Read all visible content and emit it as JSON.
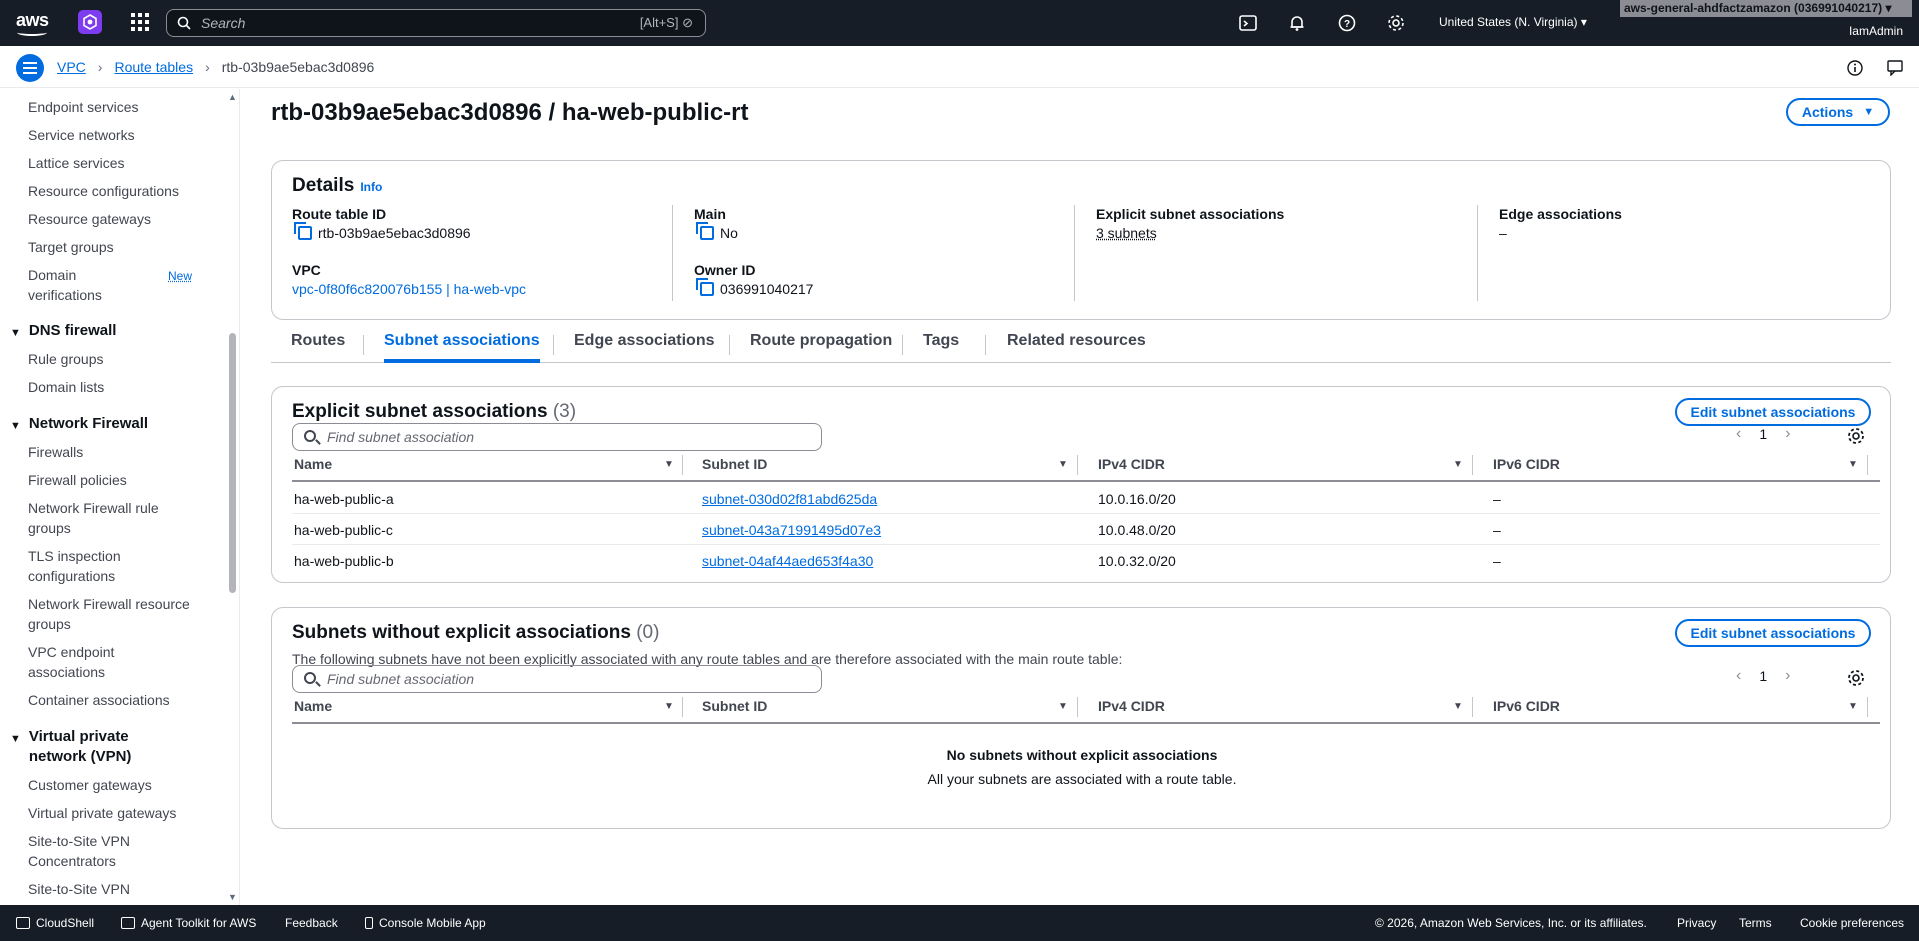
{
  "topnav": {
    "logo": "aws",
    "search_placeholder": "Search",
    "search_shortcut": "[Alt+S]",
    "region": "United States (N. Virginia) ▾",
    "account": "aws-general-ahdfactzamazon (036991040217) ▾",
    "user": "IamAdmin",
    "icons": [
      "cloudshell-icon",
      "bell-icon",
      "help-icon",
      "gear-icon"
    ]
  },
  "breadcrumb": {
    "items": [
      "VPC",
      "Route tables"
    ],
    "current": "rtb-03b9ae5ebac3d0896"
  },
  "sidebar": {
    "items_top": [
      "Endpoint services",
      "Service networks",
      "Lattice services",
      "Resource configurations",
      "Resource gateways",
      "Target groups"
    ],
    "domain_verifications": "Domain verifications",
    "new_badge": "New",
    "dns_firewall": {
      "title": "DNS firewall",
      "items": [
        "Rule groups",
        "Domain lists"
      ]
    },
    "network_firewall": {
      "title": "Network Firewall",
      "items": [
        "Firewalls",
        "Firewall policies",
        "Network Firewall rule groups",
        "TLS inspection configurations",
        "Network Firewall resource groups",
        "VPC endpoint associations",
        "Container associations"
      ]
    },
    "vpn": {
      "title": "Virtual private network (VPN)",
      "items": [
        "Customer gateways",
        "Virtual private gateways",
        "Site-to-Site VPN Concentrators",
        "Site-to-Site VPN"
      ]
    }
  },
  "page": {
    "title": "rtb-03b9ae5ebac3d0896 / ha-web-public-rt",
    "actions_label": "Actions"
  },
  "details": {
    "heading": "Details",
    "info": "Info",
    "route_table_id_label": "Route table ID",
    "route_table_id": "rtb-03b9ae5ebac3d0896",
    "main_label": "Main",
    "main": "No",
    "explicit_label": "Explicit subnet associations",
    "explicit": "3 subnets",
    "edge_label": "Edge associations",
    "edge": "–",
    "vpc_label": "VPC",
    "vpc": "vpc-0f80f6c820076b155 | ha-web-vpc",
    "owner_label": "Owner ID",
    "owner": "036991040217"
  },
  "tabs": [
    "Routes",
    "Subnet associations",
    "Edge associations",
    "Route propagation",
    "Tags",
    "Related resources"
  ],
  "explicit_table": {
    "title": "Explicit subnet associations",
    "count": "(3)",
    "edit_label": "Edit subnet associations",
    "find_placeholder": "Find subnet association",
    "page": "1",
    "columns": [
      "Name",
      "Subnet ID",
      "IPv4 CIDR",
      "IPv6 CIDR"
    ],
    "rows": [
      {
        "name": "ha-web-public-a",
        "subnet": "subnet-030d02f81abd625da",
        "ipv4": "10.0.16.0/20",
        "ipv6": "–"
      },
      {
        "name": "ha-web-public-c",
        "subnet": "subnet-043a71991495d07e3",
        "ipv4": "10.0.48.0/20",
        "ipv6": "–"
      },
      {
        "name": "ha-web-public-b",
        "subnet": "subnet-04af44aed653f4a30",
        "ipv4": "10.0.32.0/20",
        "ipv6": "–"
      }
    ]
  },
  "without_table": {
    "title": "Subnets without explicit associations",
    "count": "(0)",
    "edit_label": "Edit subnet associations",
    "description": "The following subnets have not been explicitly associated with any route tables and are therefore associated with the main route table:",
    "find_placeholder": "Find subnet association",
    "page": "1",
    "columns": [
      "Name",
      "Subnet ID",
      "IPv4 CIDR",
      "IPv6 CIDR"
    ],
    "empty_title": "No subnets without explicit associations",
    "empty_sub": "All your subnets are associated with a route table."
  },
  "footer": {
    "cloudshell": "CloudShell",
    "agent": "Agent Toolkit for AWS",
    "feedback": "Feedback",
    "mobile": "Console Mobile App",
    "copyright": "© 2026, Amazon Web Services, Inc. or its affiliates.",
    "privacy": "Privacy",
    "terms": "Terms",
    "cookies": "Cookie preferences"
  }
}
